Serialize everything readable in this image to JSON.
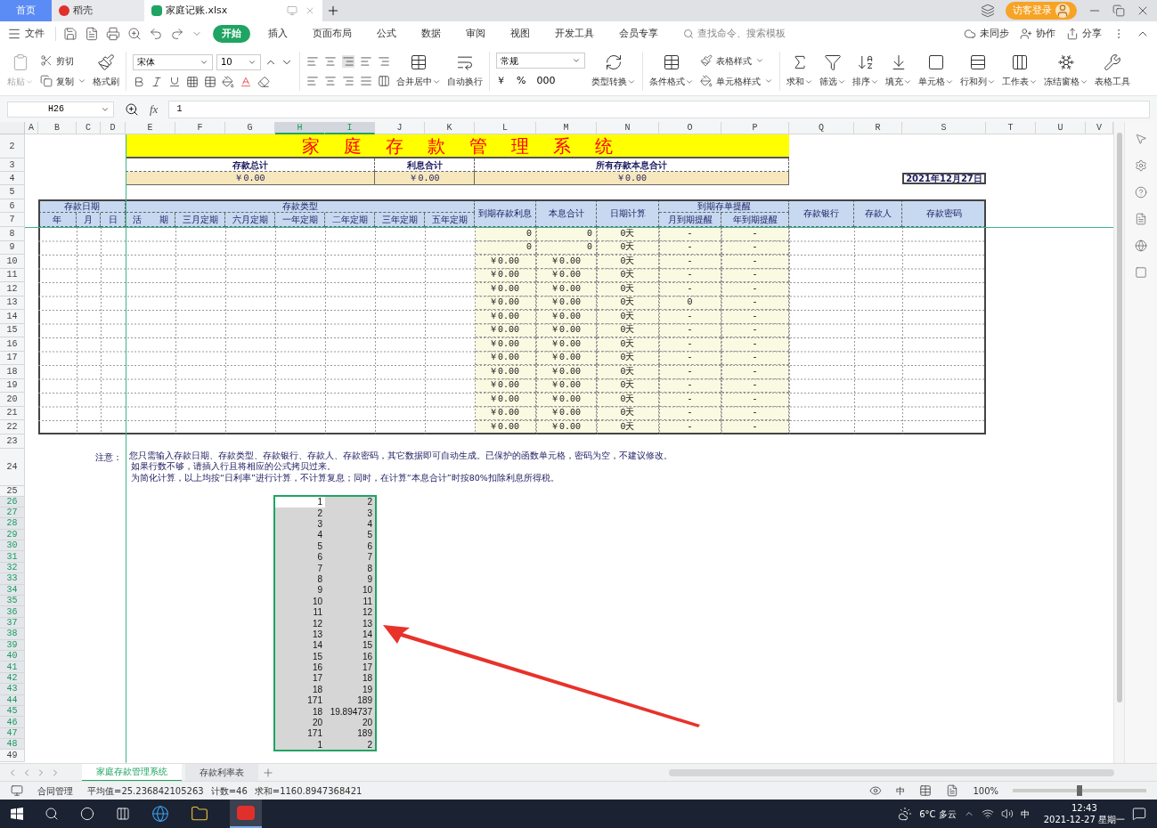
{
  "tabs": [
    {
      "label": "首页",
      "kind": "home",
      "selected": false
    },
    {
      "label": "稻壳",
      "kind": "docer",
      "selected": false
    },
    {
      "label": "家庭记账.xlsx",
      "kind": "sheet",
      "selected": true
    }
  ],
  "account": {
    "label": "访客登录"
  },
  "file_menu": "文件",
  "menu": [
    {
      "label": "开始",
      "selected": true
    },
    {
      "label": "插入",
      "selected": false
    },
    {
      "label": "页面布局",
      "selected": false
    },
    {
      "label": "公式",
      "selected": false
    },
    {
      "label": "数据",
      "selected": false
    },
    {
      "label": "审阅",
      "selected": false
    },
    {
      "label": "视图",
      "selected": false
    },
    {
      "label": "开发工具",
      "selected": false
    },
    {
      "label": "会员专享",
      "selected": false
    }
  ],
  "command_search": {
    "placeholder": "查找命令、搜索模板"
  },
  "cloud_actions": [
    "未同步",
    "协作",
    "分享"
  ],
  "ribbon": {
    "clipboard": [
      {
        "label": "粘贴",
        "disabled": true
      },
      {
        "label": "剪切",
        "disabled": false
      },
      {
        "label": "复制",
        "disabled": false
      },
      {
        "label": "格式刷",
        "disabled": false
      }
    ],
    "font": {
      "name": "宋体",
      "size": "10"
    },
    "alignment": [
      "合并居中",
      "自动换行"
    ],
    "number": {
      "format": "常规",
      "symbols": [
        "￥",
        "%",
        "000"
      ],
      "convert": "类型转换"
    },
    "tools": [
      "条件格式",
      "表格样式",
      "单元格样式",
      "求和",
      "筛选",
      "排序",
      "填充",
      "单元格",
      "行和列",
      "工作表",
      "冻结窗格",
      "表格工具"
    ]
  },
  "formula_bar": {
    "cell": "H26",
    "function_label": "fx",
    "value": "1"
  },
  "sheet": {
    "column_headers": [
      {
        "label": "A",
        "selected": false
      },
      {
        "label": "B",
        "selected": false
      },
      {
        "label": "C",
        "selected": false
      },
      {
        "label": "D",
        "selected": false
      },
      {
        "label": "E",
        "selected": false
      },
      {
        "label": "F",
        "selected": false
      },
      {
        "label": "G",
        "selected": false
      },
      {
        "label": "H",
        "selected": true
      },
      {
        "label": "I",
        "selected": true
      },
      {
        "label": "J",
        "selected": false
      },
      {
        "label": "K",
        "selected": false
      },
      {
        "label": "L",
        "selected": false
      },
      {
        "label": "M",
        "selected": false
      },
      {
        "label": "N",
        "selected": false
      },
      {
        "label": "O",
        "selected": false
      },
      {
        "label": "P",
        "selected": false
      },
      {
        "label": "Q",
        "selected": false
      },
      {
        "label": "R",
        "selected": false
      },
      {
        "label": "S",
        "selected": false
      },
      {
        "label": "T",
        "selected": false
      },
      {
        "label": "U",
        "selected": false
      },
      {
        "label": "V",
        "selected": false
      }
    ],
    "row_headers": [
      {
        "label": "2",
        "selected": false
      },
      {
        "label": "3",
        "selected": false
      },
      {
        "label": "4",
        "selected": false
      },
      {
        "label": "5",
        "selected": false
      },
      {
        "label": "6",
        "selected": false
      },
      {
        "label": "7",
        "selected": false
      },
      {
        "label": "8",
        "selected": false
      },
      {
        "label": "9",
        "selected": false
      },
      {
        "label": "10",
        "selected": false
      },
      {
        "label": "11",
        "selected": false
      },
      {
        "label": "12",
        "selected": false
      },
      {
        "label": "13",
        "selected": false
      },
      {
        "label": "14",
        "selected": false
      },
      {
        "label": "15",
        "selected": false
      },
      {
        "label": "16",
        "selected": false
      },
      {
        "label": "17",
        "selected": false
      },
      {
        "label": "18",
        "selected": false
      },
      {
        "label": "19",
        "selected": false
      },
      {
        "label": "20",
        "selected": false
      },
      {
        "label": "21",
        "selected": false
      },
      {
        "label": "22",
        "selected": false
      },
      {
        "label": "23",
        "selected": false
      },
      {
        "label": "24",
        "selected": false
      },
      {
        "label": "25",
        "selected": false
      },
      {
        "label": "26",
        "selected": true
      },
      {
        "label": "27",
        "selected": true
      },
      {
        "label": "28",
        "selected": true
      },
      {
        "label": "29",
        "selected": true
      },
      {
        "label": "30",
        "selected": true
      },
      {
        "label": "31",
        "selected": true
      },
      {
        "label": "32",
        "selected": true
      },
      {
        "label": "33",
        "selected": true
      },
      {
        "label": "34",
        "selected": true
      },
      {
        "label": "35",
        "selected": true
      },
      {
        "label": "36",
        "selected": true
      },
      {
        "label": "37",
        "selected": true
      },
      {
        "label": "38",
        "selected": true
      },
      {
        "label": "39",
        "selected": true
      },
      {
        "label": "40",
        "selected": true
      },
      {
        "label": "41",
        "selected": true
      },
      {
        "label": "42",
        "selected": true
      },
      {
        "label": "43",
        "selected": true
      },
      {
        "label": "44",
        "selected": true
      },
      {
        "label": "45",
        "selected": true
      },
      {
        "label": "46",
        "selected": true
      },
      {
        "label": "47",
        "selected": true
      },
      {
        "label": "48",
        "selected": true
      },
      {
        "label": "49",
        "selected": false
      }
    ],
    "title": "家庭存款管理系统",
    "summary": [
      {
        "label": "存款总计",
        "value": "￥0.00"
      },
      {
        "label": "利息合计",
        "value": "￥0.00"
      },
      {
        "label": "所有存款本息合计",
        "value": "￥0.00"
      }
    ],
    "date": "2021年12月27日",
    "header_groups": [
      "存款日期",
      "存款类型",
      "到期存单提醒"
    ],
    "headers": [
      "年",
      "月",
      "日",
      "活　　期",
      "三月定期",
      "六月定期",
      "一年定期",
      "二年定期",
      "三年定期",
      "五年定期",
      "到期存款利息",
      "本息合计",
      "日期计算",
      "月到期提醒",
      "年到期提醒",
      "存款银行",
      "存款人",
      "存款密码"
    ],
    "rows": [
      [
        "0",
        "0",
        "0天",
        "-",
        "-"
      ],
      [
        "0",
        "0",
        "0天",
        "-",
        "-"
      ],
      [
        "￥0.00",
        "￥0.00",
        "0天",
        "-",
        "-"
      ],
      [
        "￥0.00",
        "￥0.00",
        "0天",
        "-",
        "-"
      ],
      [
        "￥0.00",
        "￥0.00",
        "0天",
        "-",
        "-"
      ],
      [
        "￥0.00",
        "￥0.00",
        "0天",
        "0",
        "-"
      ],
      [
        "￥0.00",
        "￥0.00",
        "0天",
        "-",
        "-"
      ],
      [
        "￥0.00",
        "￥0.00",
        "0天",
        "-",
        "-"
      ],
      [
        "￥0.00",
        "￥0.00",
        "0天",
        "-",
        "-"
      ],
      [
        "￥0.00",
        "￥0.00",
        "0天",
        "-",
        "-"
      ],
      [
        "￥0.00",
        "￥0.00",
        "0天",
        "-",
        "-"
      ],
      [
        "￥0.00",
        "￥0.00",
        "0天",
        "-",
        "-"
      ],
      [
        "￥0.00",
        "￥0.00",
        "0天",
        "-",
        "-"
      ],
      [
        "￥0.00",
        "￥0.00",
        "0天",
        "-",
        "-"
      ],
      [
        "￥0.00",
        "￥0.00",
        "0天",
        "-",
        "-"
      ]
    ],
    "note": {
      "label": "注意：",
      "lines": [
        "您只需输入存款日期、存款类型、存款银行、存款人、存款密码，其它数据即可自动生成。已保护的函数单元格，密码为空，不建议修改。",
        "如果行数不够，请插入行且将相应的公式拷贝过来。",
        "为简化计算，以上均按“日利率”进行计算，不计算复息；同时，在计算“本息合计”时按80%扣除利息所得税。"
      ]
    },
    "selection": [
      {
        "cells": [
          "1",
          "2"
        ],
        "active": true
      },
      {
        "cells": [
          "2",
          "3"
        ],
        "active": false
      },
      {
        "cells": [
          "3",
          "4"
        ],
        "active": false
      },
      {
        "cells": [
          "4",
          "5"
        ],
        "active": false
      },
      {
        "cells": [
          "5",
          "6"
        ],
        "active": false
      },
      {
        "cells": [
          "6",
          "7"
        ],
        "active": false
      },
      {
        "cells": [
          "7",
          "8"
        ],
        "active": false
      },
      {
        "cells": [
          "8",
          "9"
        ],
        "active": false
      },
      {
        "cells": [
          "9",
          "10"
        ],
        "active": false
      },
      {
        "cells": [
          "10",
          "11"
        ],
        "active": false
      },
      {
        "cells": [
          "11",
          "12"
        ],
        "active": false
      },
      {
        "cells": [
          "12",
          "13"
        ],
        "active": false
      },
      {
        "cells": [
          "13",
          "14"
        ],
        "active": false
      },
      {
        "cells": [
          "14",
          "15"
        ],
        "active": false
      },
      {
        "cells": [
          "15",
          "16"
        ],
        "active": false
      },
      {
        "cells": [
          "16",
          "17"
        ],
        "active": false
      },
      {
        "cells": [
          "17",
          "18"
        ],
        "active": false
      },
      {
        "cells": [
          "18",
          "19"
        ],
        "active": false
      },
      {
        "cells": [
          "171",
          "189"
        ],
        "active": false
      },
      {
        "cells": [
          "18",
          "19.894737"
        ],
        "active": false
      },
      {
        "cells": [
          "20",
          "20"
        ],
        "active": false
      },
      {
        "cells": [
          "171",
          "189"
        ],
        "active": false
      },
      {
        "cells": [
          "1",
          "2"
        ],
        "active": false
      }
    ]
  },
  "sheet_tabs": [
    {
      "label": "家庭存款管理系统",
      "selected": true
    },
    {
      "label": "存款利率表",
      "selected": false
    }
  ],
  "status_bar": {
    "app": "合同管理",
    "average": "平均值=25.236842105263",
    "count": "计数=46",
    "sum": "求和=1160.8947368421",
    "input": "中",
    "zoom": "100%",
    "zoom_level": {
      "level": 0.5
    }
  },
  "taskbar": {
    "weather": "6°C 多云",
    "ime": "中",
    "time": "12:43",
    "date": "2021-12-27 星期一"
  }
}
